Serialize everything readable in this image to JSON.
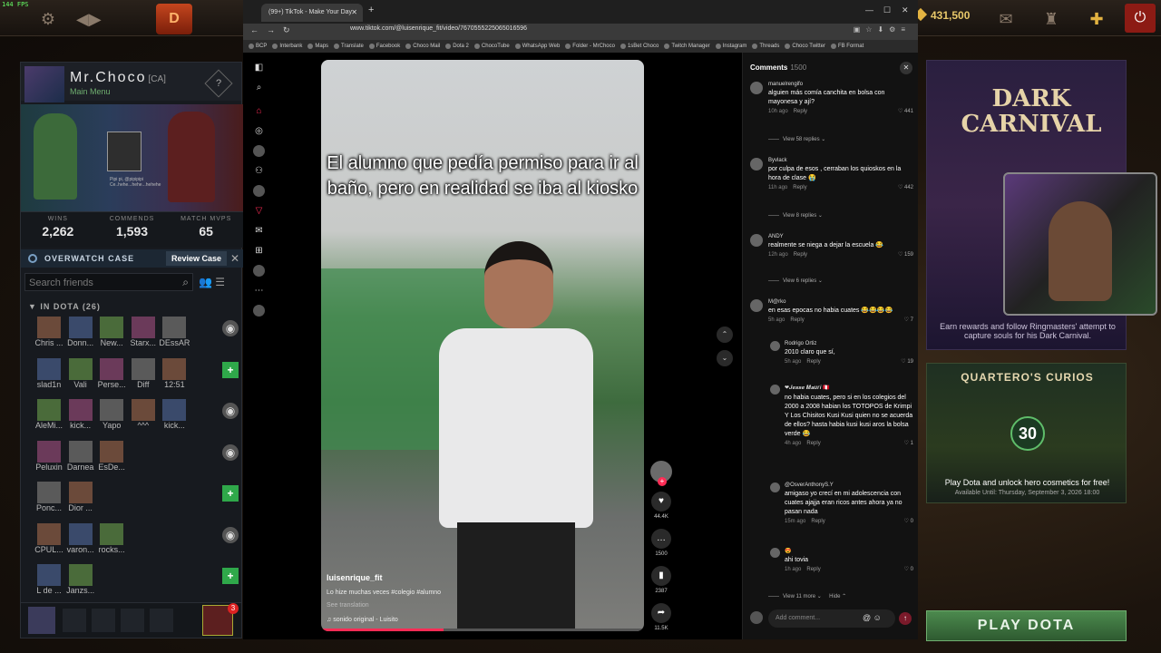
{
  "dota": {
    "fps": "144 FPS",
    "logo": "D",
    "shards": "431,500",
    "profile": {
      "name": "Mr.Choco",
      "tag": "[CA]",
      "subtitle": "Main Menu",
      "chat_line1": "Pipi pi, @pipipipi",
      "chat_line2": "Ce..hehe...hehe...hehehe",
      "stats": [
        {
          "label": "WINS",
          "value": "2,262"
        },
        {
          "label": "COMMENDS",
          "value": "1,593"
        },
        {
          "label": "MATCH MVPS",
          "value": "65"
        }
      ]
    },
    "overwatch": {
      "label": "OVERWATCH CASE",
      "button": "Review Case"
    },
    "search_placeholder": "Search friends",
    "group_label": "IN DOTA (26)",
    "friend_rows": [
      {
        "names": [
          "Chris ...",
          "Donn...",
          "New...",
          "Starx...",
          "DEssAR"
        ],
        "action": "eye"
      },
      {
        "names": [
          "slad1n",
          "Vali",
          "Perse...",
          "Diff",
          "12:51"
        ],
        "action": "plus"
      },
      {
        "names": [
          "AleMi...",
          "kick...",
          "Yapo",
          "^^^",
          "kick..."
        ],
        "action": "eye"
      },
      {
        "names": [
          "Peluxin",
          "Darnea",
          "EsDe...",
          "",
          ""
        ],
        "action": "eye"
      },
      {
        "names": [
          "Ponc...",
          "Dior ...",
          "",
          "",
          ""
        ],
        "action": "plus"
      },
      {
        "names": [
          "CPUL...",
          "varon...",
          "rocks...",
          "",
          ""
        ],
        "action": "eye"
      },
      {
        "names": [
          "L de ...",
          "Janzs...",
          "",
          "",
          ""
        ],
        "action": "plus"
      }
    ],
    "party_badge": "3",
    "carnival": {
      "title": "DARK CARNIVAL",
      "desc": "Earn rewards and follow Ringmasters' attempt to capture souls for his Dark Carnival."
    },
    "curios": {
      "title": "QUARTERO'S CURIOS",
      "number": "30",
      "desc": "Play Dota and unlock hero cosmetics for free!",
      "avail": "Available Until: Thursday, September 3, 2026 18:00"
    },
    "play_button": "PLAY DOTA"
  },
  "browser": {
    "tab_title": "(99+) TikTok - Make Your Day",
    "url": "www.tiktok.com/@luisenrique_fit/video/7670555225065016596",
    "bookmarks": [
      "BCP",
      "Interbank",
      "Maps",
      "Translate",
      "Facebook",
      "Choco Mail",
      "Dota 2",
      "ChocoTube",
      "WhatsApp Web",
      "Folder - MrChoco",
      "1sBet Choco",
      "Twitch Manager",
      "Instagram",
      "Threads",
      "Choco Twitter",
      "FB Format"
    ]
  },
  "video": {
    "caption": "El alumno que pedía permiso para ir al baño, pero en realidad se iba al kiosko",
    "author": "luisenrique_fit",
    "description": "Lo hize muchas veces #colegio #alumno",
    "see_translation": "See translation",
    "sound": "sonido original - Luisito",
    "progress": 0.38,
    "likes": "44.4K",
    "comments": "1500",
    "saves": "2387",
    "shares": "11.5K"
  },
  "comments": {
    "title": "Comments",
    "count": "1500",
    "items": [
      {
        "user": "manuelrengifo",
        "text": "alguien más comía canchita en bolsa con mayonesa y ají?",
        "time": "10h ago",
        "likes": "441",
        "more": "View 58 replies"
      },
      {
        "user": "Byvlack",
        "text": "por culpa de esos , cerraban los quioskos en la hora de clase 😭",
        "time": "11h ago",
        "likes": "442",
        "more": "View 8 replies"
      },
      {
        "user": "ANDY",
        "text": "realmente se niega a dejar la escuela 😂",
        "time": "12h ago",
        "likes": "159",
        "more": "View 6 replies"
      },
      {
        "user": "M@rko",
        "text": "en esas epocas no habia cuates 😂😂😂😂",
        "time": "5h ago",
        "likes": "7"
      }
    ],
    "replies": [
      {
        "user": "Rodrigo Ortiz",
        "text": "2010 claro que sí,",
        "time": "5h ago",
        "likes": "19"
      },
      {
        "user": "❤𝑱𝒆𝒔𝒔𝒆 𝑴𝒂𝒖𝒓𝒊 🇵🇪",
        "text": "no habia cuates, pero si en los colegios del 2000 a 2008 habian los TOTOPOS de Krimpi Y Los Chisitos Kusi Kusi quien no se acuerda de ellos? hasta habia kusi kusi aros la bolsa verde 😂",
        "time": "4h ago",
        "likes": "1"
      },
      {
        "user": "@OsverAnthonyS.Y",
        "text": "amigaso yo crecí en mi adolescencia con cuates ajajja eran ricos antes ahora ya no pasan nada",
        "time": "15m ago",
        "likes": "0"
      },
      {
        "user": "😍",
        "text": "ahi tovia",
        "time": "1h ago",
        "likes": "0"
      }
    ],
    "view_more": "View 11 more",
    "hide": "Hide",
    "reply_label": "Reply",
    "input_placeholder": "Add comment..."
  }
}
